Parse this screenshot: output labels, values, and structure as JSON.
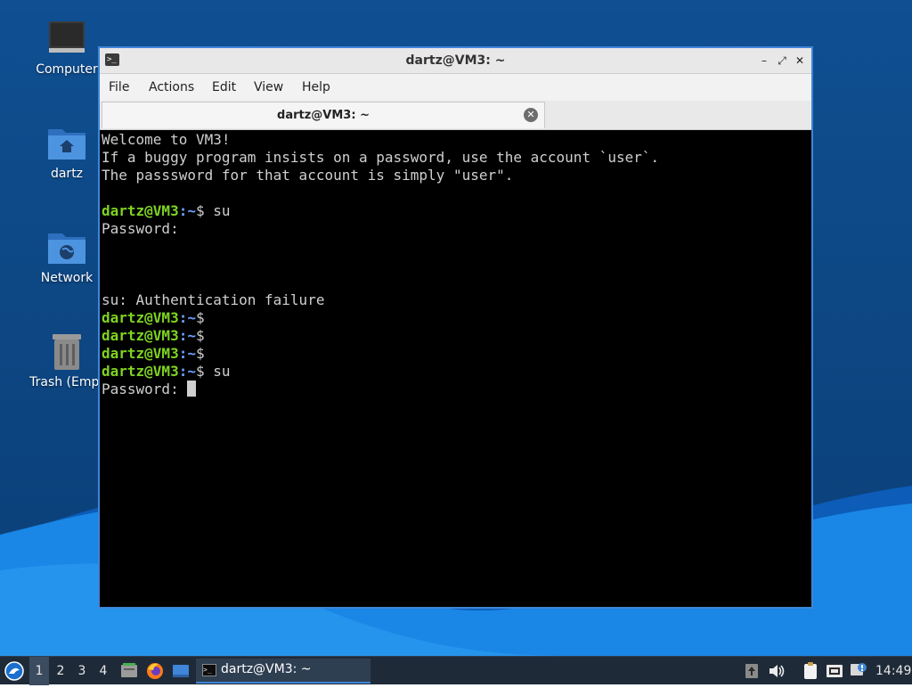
{
  "desktop": {
    "icons": [
      {
        "label": "Computer",
        "icon": "computer-icon"
      },
      {
        "label": "dartz",
        "icon": "home-folder-icon"
      },
      {
        "label": "Network",
        "icon": "network-folder-icon"
      },
      {
        "label": "Trash (Empt",
        "icon": "trash-icon"
      }
    ],
    "colors": {
      "wallpaper": "#0d4784",
      "wave": "#1a7fe0"
    }
  },
  "window": {
    "title": "dartz@VM3: ~",
    "controls": {
      "minimize": "–",
      "maximize": "⤢",
      "close": "✕"
    },
    "menu": [
      "File",
      "Actions",
      "Edit",
      "View",
      "Help"
    ],
    "tab": {
      "label": "dartz@VM3: ~",
      "close": "✕"
    },
    "border_color": "#3f85d8"
  },
  "terminal": {
    "prompt_user": "dartz@VM3",
    "prompt_path": ":~",
    "prompt_end": "$",
    "lines": [
      {
        "type": "text",
        "text": "Welcome to VM3!"
      },
      {
        "type": "text",
        "text": "If a buggy program insists on a password, use the account `user`."
      },
      {
        "type": "text",
        "text": "The passsword for that account is simply \"user\"."
      },
      {
        "type": "text",
        "text": ""
      },
      {
        "type": "prompt",
        "cmd": " su"
      },
      {
        "type": "text",
        "text": "Password:"
      },
      {
        "type": "text",
        "text": ""
      },
      {
        "type": "text",
        "text": ""
      },
      {
        "type": "text",
        "text": ""
      },
      {
        "type": "text",
        "text": "su: Authentication failure"
      },
      {
        "type": "prompt",
        "cmd": ""
      },
      {
        "type": "prompt",
        "cmd": ""
      },
      {
        "type": "prompt",
        "cmd": ""
      },
      {
        "type": "prompt",
        "cmd": " su"
      },
      {
        "type": "cursor",
        "text": "Password: "
      }
    ],
    "colors": {
      "user": "#7ed321",
      "path": "#6ea2ff",
      "text": "#cfcfcf"
    }
  },
  "taskbar": {
    "workspaces": [
      "1",
      "2",
      "3",
      "4"
    ],
    "active_workspace": "1",
    "launchers": [
      "file-manager-icon",
      "firefox-icon",
      "show-desktop-icon"
    ],
    "task_label": "dartz@VM3: ~",
    "tray": [
      "update-notifier-icon",
      "volume-icon",
      "clipboard-icon",
      "network-icon",
      "notification-icon"
    ],
    "clock": "14:49"
  }
}
